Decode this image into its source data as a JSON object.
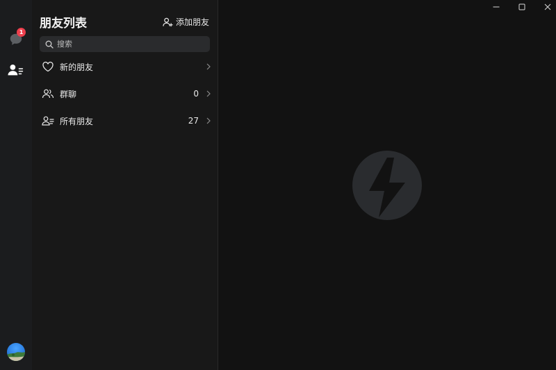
{
  "rail": {
    "chat_badge_count": "1",
    "chat_icon": "chat-bubble-icon",
    "contacts_icon": "contacts-icon"
  },
  "panel": {
    "title": "朋友列表",
    "add_friend_label": "添加朋友",
    "search_placeholder": "搜索",
    "items": [
      {
        "label": "新的朋友",
        "count": "",
        "icon": "heart-icon"
      },
      {
        "label": "群聊",
        "count": "0",
        "icon": "group-icon"
      },
      {
        "label": "所有朋友",
        "count": "27",
        "icon": "contacts-list-icon"
      }
    ]
  },
  "window": {
    "controls": [
      "minimize",
      "maximize",
      "close"
    ]
  },
  "colors": {
    "background": "#121212",
    "rail": "#1b1c1e",
    "panel": "#181818",
    "badge": "#ee3f4d",
    "logo": "#2a2c2f"
  }
}
